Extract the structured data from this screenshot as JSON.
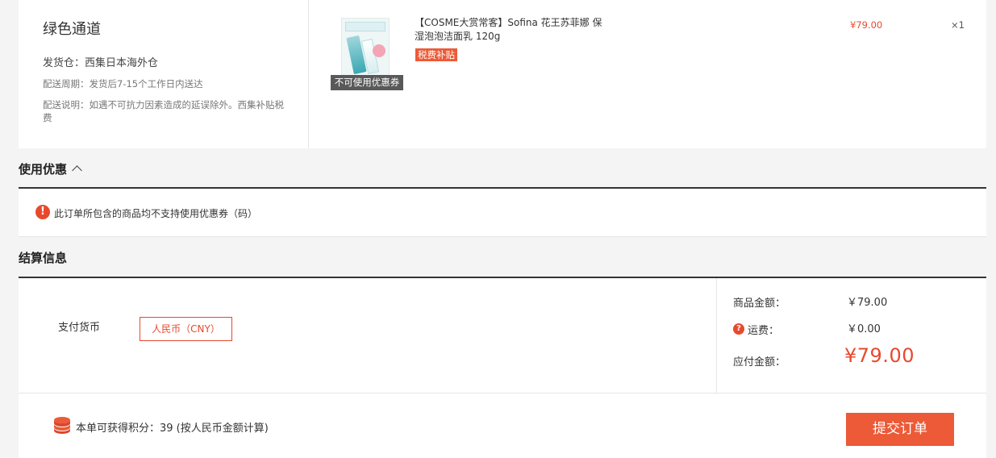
{
  "channel": {
    "title": "绿色通道",
    "warehouse": "发货仓：西集日本海外仓",
    "delivery_period": "配送周期：发货后7-15个工作日内送达",
    "delivery_note": "配送说明：如遇不可抗力因素造成的延误除外。西集补贴税费"
  },
  "product": {
    "coupon_ribbon": "不可使用优惠券",
    "name": "【COSME大赏常客】Sofina 花王苏菲娜 保湿泡泡洁面乳 120g",
    "tax_badge": "税费补贴",
    "price": "¥79.00",
    "quantity": "×1"
  },
  "coupon_section": {
    "heading": "使用优惠",
    "alert_icon": "!",
    "message": "此订单所包含的商品均不支持使用优惠券（码）"
  },
  "settlement": {
    "heading": "结算信息",
    "currency_label": "支付货币",
    "currency_value": "人民币（CNY）",
    "goods_amount_label": "商品金额：",
    "goods_amount": "￥79.00",
    "help_icon": "?",
    "shipping_label": "运费：",
    "shipping_amount": "￥0.00",
    "payable_label": "应付金额：",
    "payable_amount": "¥79.00",
    "points_text": "本单可获得积分：39 (按人民币金额计算)",
    "submit_label": "提交订单"
  },
  "colors": {
    "accent": "#ec5a37",
    "price_red": "#e8492d",
    "dark_rule": "#333333"
  },
  "icons": [
    "alert-icon",
    "chevron-up-icon",
    "help-icon",
    "coins-icon"
  ]
}
